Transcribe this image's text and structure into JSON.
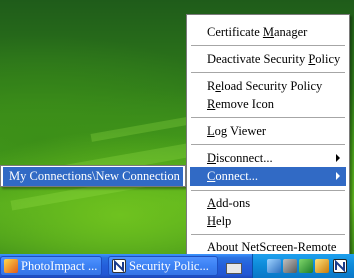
{
  "menu": {
    "items": [
      {
        "pre": "Certificate ",
        "ul": "M",
        "post": "anager"
      },
      {
        "pre": "Deactivate Security ",
        "ul": "P",
        "post": "olicy"
      },
      {
        "pre": "R",
        "ul": "e",
        "post": "load Security Policy"
      },
      {
        "pre": "",
        "ul": "R",
        "post": "emove Icon"
      },
      {
        "pre": "",
        "ul": "L",
        "post": "og Viewer"
      },
      {
        "pre": "",
        "ul": "D",
        "post": "isconnect..."
      },
      {
        "pre": "",
        "ul": "C",
        "post": "onnect..."
      },
      {
        "pre": "",
        "ul": "A",
        "post": "dd-ons"
      },
      {
        "pre": "",
        "ul": "H",
        "post": "elp"
      },
      {
        "pre": "About NetScreen-Remote",
        "ul": "",
        "post": ""
      }
    ]
  },
  "submenu": {
    "item": "My Connections\\New Connection"
  },
  "taskbar": {
    "buttons": [
      {
        "label": "PhotoImpact ...",
        "icon": "photoimpact-icon"
      },
      {
        "label": "Security Polic...",
        "icon": "netscreen-icon"
      }
    ],
    "tray_icons": [
      "network-icon",
      "speaker-icon",
      "shield-icon",
      "security-icon",
      "netscreen-n-icon"
    ]
  },
  "colors": {
    "highlight": "#316ac5",
    "taskbar": "#245edb",
    "tray": "#0d8ad8"
  }
}
